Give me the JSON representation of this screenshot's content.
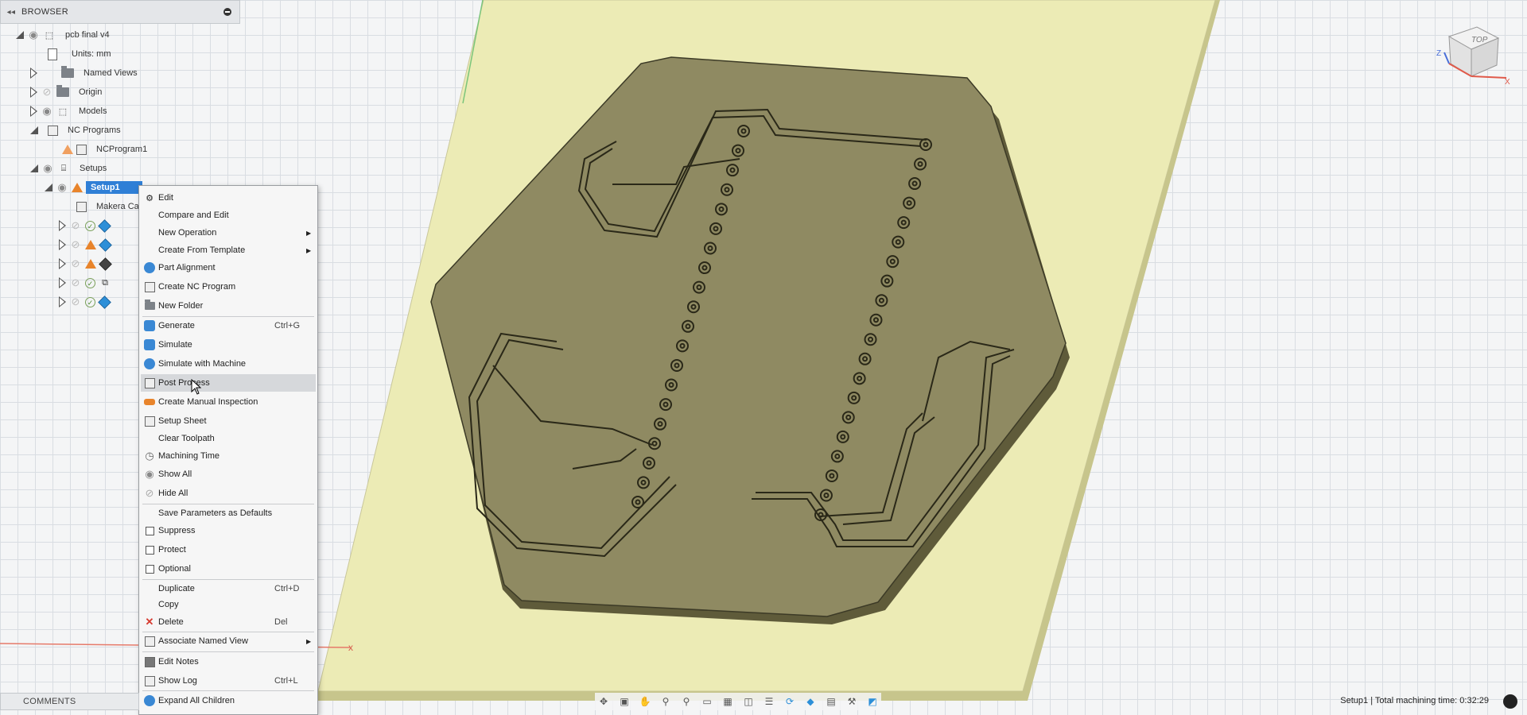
{
  "browser": {
    "title": "BROWSER",
    "collapse_icon": "double-left-arrow",
    "tree": [
      {
        "label": "pcb final v4",
        "icon": "component-icon"
      },
      {
        "label": "Units: mm",
        "icon": "document-icon"
      },
      {
        "label": "Named Views",
        "icon": "folder-icon"
      },
      {
        "label": "Origin",
        "icon": "folder-icon"
      },
      {
        "label": "Models",
        "icon": "component-icon"
      },
      {
        "label": "NC Programs",
        "icon": "nc-program-icon"
      },
      {
        "label": "NCProgram1",
        "icon": "nc-program-icon"
      },
      {
        "label": "Setups",
        "icon": "setups-icon"
      },
      {
        "label": "Setup1",
        "icon": "setup-icon"
      },
      {
        "label": "Makera Ca",
        "icon": "machine-icon"
      }
    ]
  },
  "context_menu": {
    "items": [
      {
        "label": "Edit",
        "shortcut": "",
        "icon": "gear-icon",
        "submenu": false
      },
      {
        "label": "Compare and Edit",
        "shortcut": "",
        "icon": "",
        "submenu": false
      },
      {
        "label": "New Operation",
        "shortcut": "",
        "icon": "",
        "submenu": true
      },
      {
        "label": "Create From Template",
        "shortcut": "",
        "icon": "",
        "submenu": true
      },
      {
        "label": "Part Alignment",
        "shortcut": "",
        "icon": "part-alignment-icon",
        "submenu": false
      },
      {
        "label": "Create NC Program",
        "shortcut": "",
        "icon": "nc-program-icon",
        "submenu": false
      },
      {
        "label": "New Folder",
        "shortcut": "",
        "icon": "folder-icon",
        "submenu": false
      },
      {
        "label": "Generate",
        "shortcut": "Ctrl+G",
        "icon": "generate-icon",
        "submenu": false
      },
      {
        "label": "Simulate",
        "shortcut": "",
        "icon": "simulate-icon",
        "submenu": false
      },
      {
        "label": "Simulate with Machine",
        "shortcut": "",
        "icon": "simulate-machine-icon",
        "submenu": false
      },
      {
        "label": "Post Process",
        "shortcut": "",
        "icon": "post-process-icon",
        "submenu": false
      },
      {
        "label": "Create Manual Inspection",
        "shortcut": "",
        "icon": "inspection-icon",
        "submenu": false
      },
      {
        "label": "Setup Sheet",
        "shortcut": "",
        "icon": "setup-sheet-icon",
        "submenu": false
      },
      {
        "label": "Clear Toolpath",
        "shortcut": "",
        "icon": "",
        "submenu": false
      },
      {
        "label": "Machining Time",
        "shortcut": "",
        "icon": "clock-icon",
        "submenu": false
      },
      {
        "label": "Show All",
        "shortcut": "",
        "icon": "eye-icon",
        "submenu": false
      },
      {
        "label": "Hide All",
        "shortcut": "",
        "icon": "eye-off-icon",
        "submenu": false
      },
      {
        "label": "Save Parameters as Defaults",
        "shortcut": "",
        "icon": "",
        "submenu": false
      },
      {
        "label": "Suppress",
        "shortcut": "",
        "icon": "checkbox",
        "submenu": false
      },
      {
        "label": "Protect",
        "shortcut": "",
        "icon": "checkbox",
        "submenu": false
      },
      {
        "label": "Optional",
        "shortcut": "",
        "icon": "checkbox",
        "submenu": false
      },
      {
        "label": "Duplicate",
        "shortcut": "Ctrl+D",
        "icon": "",
        "submenu": false
      },
      {
        "label": "Copy",
        "shortcut": "",
        "icon": "",
        "submenu": false
      },
      {
        "label": "Delete",
        "shortcut": "Del",
        "icon": "delete-x-icon",
        "submenu": false
      },
      {
        "label": "Associate Named View",
        "shortcut": "",
        "icon": "named-view-icon",
        "submenu": true
      },
      {
        "label": "Edit Notes",
        "shortcut": "",
        "icon": "notes-icon",
        "submenu": false
      },
      {
        "label": "Show Log",
        "shortcut": "Ctrl+L",
        "icon": "log-icon",
        "submenu": false
      },
      {
        "label": "Expand All Children",
        "shortcut": "",
        "icon": "expand-icon",
        "submenu": false
      }
    ],
    "hovered": "Post Process"
  },
  "comments": {
    "label": "COMMENTS"
  },
  "status": {
    "text": "Setup1 | Total machining time: 0:32:29"
  },
  "viewcube": {
    "face_label": "TOP",
    "axis_x": "X",
    "axis_z": "Z"
  },
  "canvas_axis_label": "x",
  "colors": {
    "accent": "#2f7fd6",
    "warning": "#e8842b",
    "ok": "#4c8a2e",
    "stock": "#ecebb5",
    "part": "#8f8a62",
    "danger": "#d63a2f"
  }
}
